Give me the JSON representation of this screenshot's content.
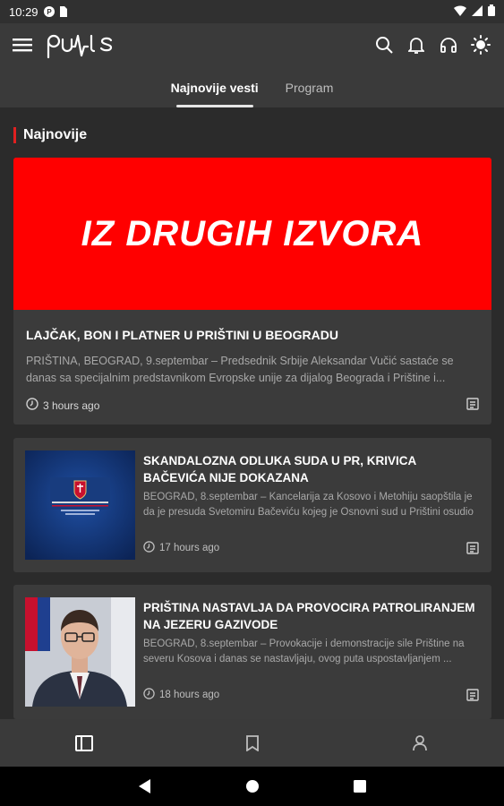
{
  "status_bar": {
    "time": "10:29",
    "icons": [
      "notification-p-icon",
      "sim-card-icon",
      "wifi-icon",
      "signal-icon",
      "battery-icon"
    ]
  },
  "app_bar": {
    "logo_text": "puls",
    "actions": [
      "search-icon",
      "bell-icon",
      "headphones-icon",
      "brightness-icon"
    ]
  },
  "tabs": [
    {
      "label": "Najnovije vesti",
      "active": true
    },
    {
      "label": "Program",
      "active": false
    }
  ],
  "section": {
    "title": "Najnovije"
  },
  "hero": {
    "banner_text": "IZ DRUGIH IZVORA",
    "title": "LAJČAK, BON I PLATNER U PRIŠTINI U BEOGRADU",
    "excerpt": "PRIŠTINA, BEOGRAD, 9.septembar – Predsednik Srbije Aleksandar Vučić sastaće se danas sa specijalnim predstavnikom Evropske unije za dijalog Beograda i Prištine i...",
    "time": "3 hours ago"
  },
  "articles": [
    {
      "title": "SKANDALOZNA ODLUKA SUDA U PR, KRIVICA BAČEVIĆA NIJE DOKAZANA",
      "excerpt": "BEOGRAD, 8.septembar – Kancelarija za Kosovo i Metohiju saopštila je da je presuda Svetomiru Bačeviću kojeg je Osnovni sud u Prištini osudio na...",
      "time": "17 hours ago"
    },
    {
      "title": "PRIŠTINA NASTAVLJA DA PROVOCIRA PATROLIRANJEM NA JEZERU GAZIVODE",
      "excerpt": "BEOGRAD, 8.septembar – Provokacije i demonstracije sile Prištine na severu Kosova i danas se nastavljaju, ovog puta uspostavljanjem ...",
      "time": "18 hours ago"
    }
  ],
  "colors": {
    "accent": "#e02020",
    "banner": "#ff0000",
    "card": "#3b3b3b",
    "background": "#2b2b2b"
  }
}
